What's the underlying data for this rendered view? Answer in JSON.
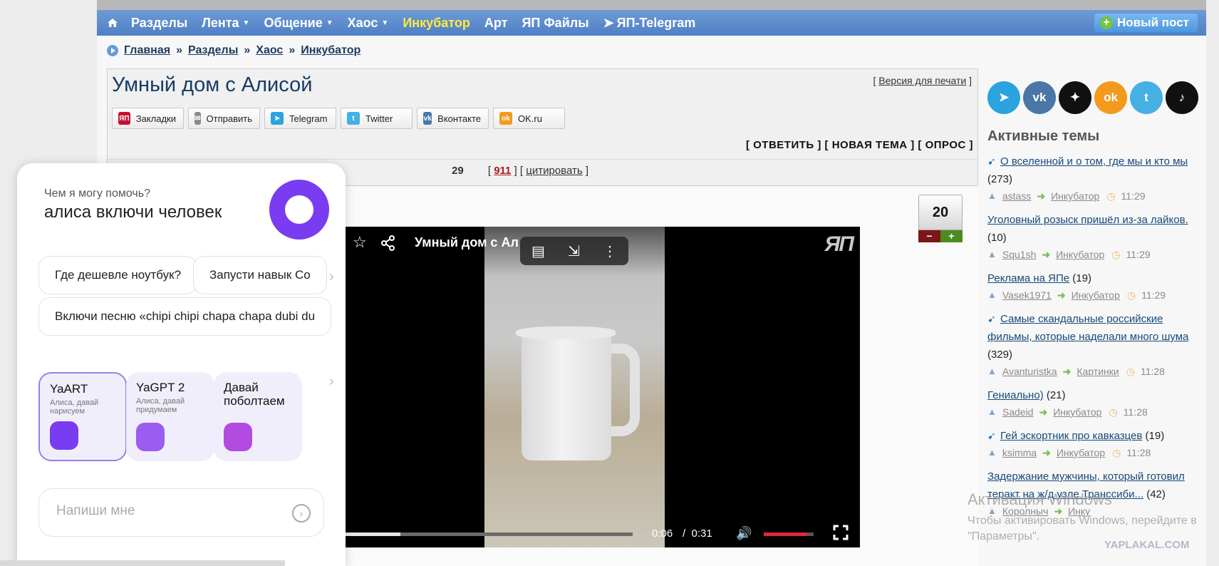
{
  "nav": {
    "items": [
      {
        "label": "Разделы",
        "caret": false,
        "highlight": false
      },
      {
        "label": "Лента",
        "caret": true,
        "highlight": false
      },
      {
        "label": "Общение",
        "caret": true,
        "highlight": false
      },
      {
        "label": "Хаос",
        "caret": true,
        "highlight": false
      },
      {
        "label": "Инкубатор",
        "caret": false,
        "highlight": true
      },
      {
        "label": "Арт",
        "caret": false,
        "highlight": false
      },
      {
        "label": "ЯП Файлы",
        "caret": false,
        "highlight": false
      },
      {
        "label": "ЯП-Telegram",
        "caret": false,
        "highlight": false
      }
    ],
    "new_post": "Новый пост",
    "colors": {
      "bar": "#5a8acb",
      "highlight": "#ffea3a"
    }
  },
  "breadcrumb": [
    "Главная",
    "Разделы",
    "Хаос",
    "Инкубатор"
  ],
  "topic": {
    "title": "Умный дом с Алисой",
    "print_link": "Версия для печати",
    "share": [
      {
        "label": "Закладки",
        "icon": "yap-bookmark-icon",
        "color": "#c8102e",
        "glyph": "ЯП"
      },
      {
        "label": "Отправить",
        "icon": "envelope-icon",
        "color": "#8a8a8a",
        "glyph": "✉"
      },
      {
        "label": "Telegram",
        "icon": "telegram-icon",
        "color": "#2aa3df",
        "glyph": "➤"
      },
      {
        "label": "Twitter",
        "icon": "twitter-icon",
        "color": "#45b0e3",
        "glyph": "t"
      },
      {
        "label": "Вконтакте",
        "icon": "vk-icon",
        "color": "#4a76a8",
        "glyph": "vk"
      },
      {
        "label": "OK.ru",
        "icon": "odnoklassniki-icon",
        "color": "#f39a1d",
        "glyph": "ok"
      }
    ],
    "actions": [
      "ОТВЕТИТЬ",
      "НОВАЯ ТЕМА",
      "ОПРОС"
    ],
    "post_time_fragment": "29",
    "post_number": "911",
    "quote_label": "цитировать",
    "rating": "20",
    "rating_minus": "−",
    "rating_plus": "+"
  },
  "video": {
    "title": "Умный дом с Ал",
    "current_time": "0:06",
    "separator": "/",
    "duration": "0:31",
    "progress_fraction": 0.19,
    "volume_fraction": 0.85,
    "logo": "ЯП"
  },
  "sidebar": {
    "social": [
      {
        "name": "telegram-icon",
        "color": "#2aa3df",
        "glyph": "➤"
      },
      {
        "name": "vk-icon",
        "color": "#4a76a8",
        "glyph": "vk"
      },
      {
        "name": "dzen-icon",
        "color": "#111111",
        "glyph": "✦"
      },
      {
        "name": "odnoklassniki-icon",
        "color": "#f39a1d",
        "glyph": "ok"
      },
      {
        "name": "twitter-icon",
        "color": "#45b0e3",
        "glyph": "t"
      },
      {
        "name": "tiktok-icon",
        "color": "#111111",
        "glyph": "♪"
      }
    ],
    "active_title": "Активные темы",
    "topics": [
      {
        "title": "О вселенной и о том, где мы и кто мы",
        "count": "(273)",
        "pinned": true,
        "user": "astass",
        "section": "Инкубатор",
        "time": "11:29"
      },
      {
        "title": "Уголовный розыск пришёл из-за лайков.",
        "count": "(10)",
        "pinned": false,
        "user": "Squ1sh",
        "section": "Инкубатор",
        "time": "11:29"
      },
      {
        "title": "Реклама на ЯПе",
        "count": "(19)",
        "pinned": false,
        "user": "Vasek1971",
        "section": "Инкубатор",
        "time": "11:29"
      },
      {
        "title": "Самые скандальные российские фильмы, которые наделали много шума",
        "count": "(329)",
        "pinned": true,
        "user": "Avanturistka",
        "section": "Картинки",
        "time": "11:28"
      },
      {
        "title": "Гениально)",
        "count": "(21)",
        "pinned": false,
        "user": "Sadeid",
        "section": "Инкубатор",
        "time": "11:28"
      },
      {
        "title": "Гей эскортник про кавказцев",
        "count": "(19)",
        "pinned": true,
        "user": "ksimma",
        "section": "Инкубатор",
        "time": "11:28"
      },
      {
        "title": "Задержание мужчины, который готовил теракт на ж/д узле Транссиби...",
        "count": "(42)",
        "pinned": false,
        "user": "Королныч",
        "section": "Инку",
        "time": ""
      }
    ]
  },
  "watermark": {
    "line1": "Активация Windows",
    "line2": "Чтобы активировать Windows, перейдите в",
    "line3": "\"Параметры\".",
    "site": "YAPLAKAL.COM"
  },
  "alice": {
    "prompt": "Чем я могу помочь?",
    "query": "алиса включи человек",
    "suggestions": [
      "Где дешевле ноутбук?",
      "Запусти навык Со",
      "Включи песню «chipi chipi chapa chapa dubi du"
    ],
    "cards": [
      {
        "name": "YaART",
        "sub": "Алиса, давай нарисуем",
        "color": "#7a3cf0",
        "selected": true
      },
      {
        "name": "YaGPT 2",
        "sub": "Алиса, давай придумаем",
        "color": "#9b5cf0",
        "selected": false
      },
      {
        "name": "Давай поболтаем",
        "sub": "",
        "color": "#b24ce0",
        "selected": false
      }
    ],
    "input_placeholder": "Напиши мне"
  }
}
